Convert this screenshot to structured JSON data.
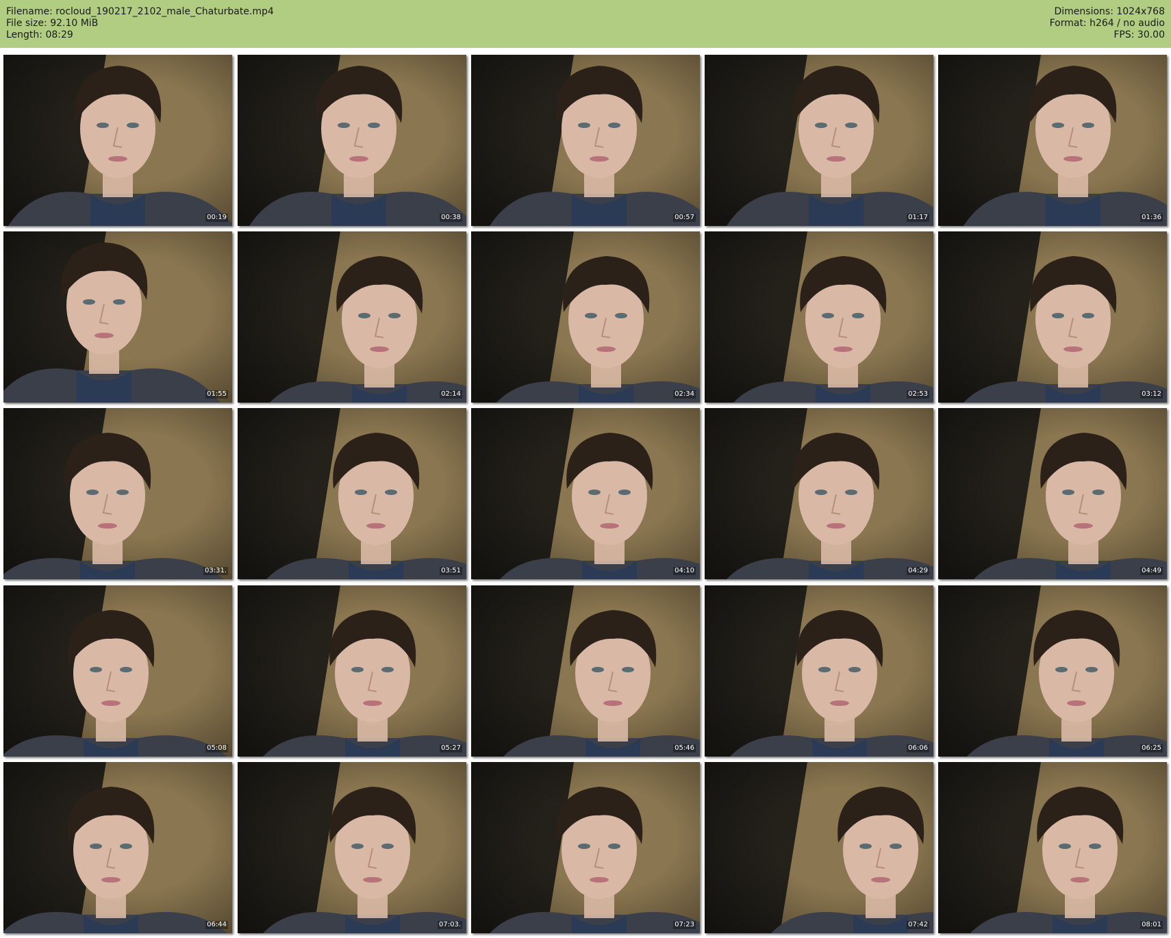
{
  "header": {
    "filename_line": "Filename: rocloud_190217_2102_male_Chaturbate.mp4",
    "filesize_line": "File size: 92.10 MiB",
    "length_line": "Length: 08:29",
    "dimensions_line": "Dimensions: 1024x768",
    "format_line": "Format: h264 / no audio",
    "fps_line": "FPS: 30.00"
  },
  "colors": {
    "header_bg": "#b1cd81",
    "page_bg": "#ffffff",
    "wall": "#8a7650",
    "dark_panel": "#1f1c18",
    "hair": "#2b2119",
    "skin": "#d9b9a5",
    "hoodie": "#3b3f4a",
    "shirt": "#2c3b55"
  },
  "thumbnails": [
    {
      "timestamp": "00:19"
    },
    {
      "timestamp": "00:38"
    },
    {
      "timestamp": "00:57"
    },
    {
      "timestamp": "01:17"
    },
    {
      "timestamp": "01:36"
    },
    {
      "timestamp": "01:55"
    },
    {
      "timestamp": "02:14"
    },
    {
      "timestamp": "02:34"
    },
    {
      "timestamp": "02:53"
    },
    {
      "timestamp": "03:12"
    },
    {
      "timestamp": "03:31."
    },
    {
      "timestamp": "03:51"
    },
    {
      "timestamp": "04:10"
    },
    {
      "timestamp": "04:29"
    },
    {
      "timestamp": "04:49"
    },
    {
      "timestamp": "05:08"
    },
    {
      "timestamp": "05:27"
    },
    {
      "timestamp": "05:46"
    },
    {
      "timestamp": "06:06"
    },
    {
      "timestamp": "06:25"
    },
    {
      "timestamp": "06:44"
    },
    {
      "timestamp": "07:03."
    },
    {
      "timestamp": "07:23"
    },
    {
      "timestamp": "07:42"
    },
    {
      "timestamp": "08:01"
    }
  ]
}
